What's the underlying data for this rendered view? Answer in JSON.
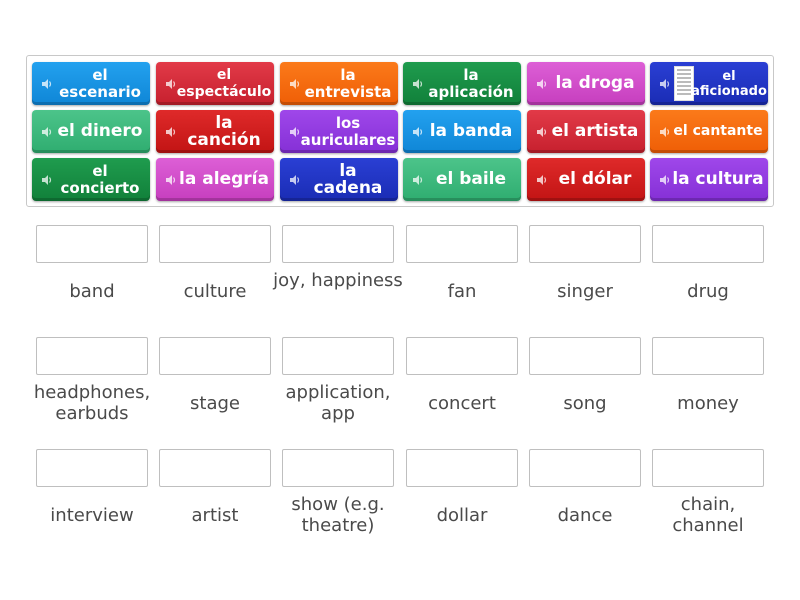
{
  "tiles": [
    {
      "label": "el escenario",
      "color": "c-blue"
    },
    {
      "label": "el espectáculo",
      "color": "c-red"
    },
    {
      "label": "la entrevista",
      "color": "c-orange"
    },
    {
      "label": "la aplicación",
      "color": "c-dgreen"
    },
    {
      "label": "la droga",
      "color": "c-pink"
    },
    {
      "label": "el aficionado",
      "color": "c-navy"
    },
    {
      "label": "el dinero",
      "color": "c-lgreen"
    },
    {
      "label": "la canción",
      "color": "c-dred"
    },
    {
      "label": "los auriculares",
      "color": "c-purple"
    },
    {
      "label": "la banda",
      "color": "c-blue"
    },
    {
      "label": "el artista",
      "color": "c-red"
    },
    {
      "label": "el cantante",
      "color": "c-orange"
    },
    {
      "label": "el concierto",
      "color": "c-dgreen"
    },
    {
      "label": "la alegría",
      "color": "c-pink"
    },
    {
      "label": "la cadena",
      "color": "c-navy"
    },
    {
      "label": "el baile",
      "color": "c-lgreen"
    },
    {
      "label": "el dólar",
      "color": "c-dred"
    },
    {
      "label": "la cultura",
      "color": "c-purple"
    }
  ],
  "definitions": [
    "band",
    "culture",
    "joy, happiness",
    "fan",
    "singer",
    "drug",
    "headphones, earbuds",
    "stage",
    "application, app",
    "concert",
    "song",
    "money",
    "interview",
    "artist",
    "show (e.g. theatre)",
    "dollar",
    "dance",
    "chain, channel"
  ],
  "icons": {
    "tile_icon": "speaker-icon",
    "thumbnail": "image-thumbnail-icon"
  }
}
